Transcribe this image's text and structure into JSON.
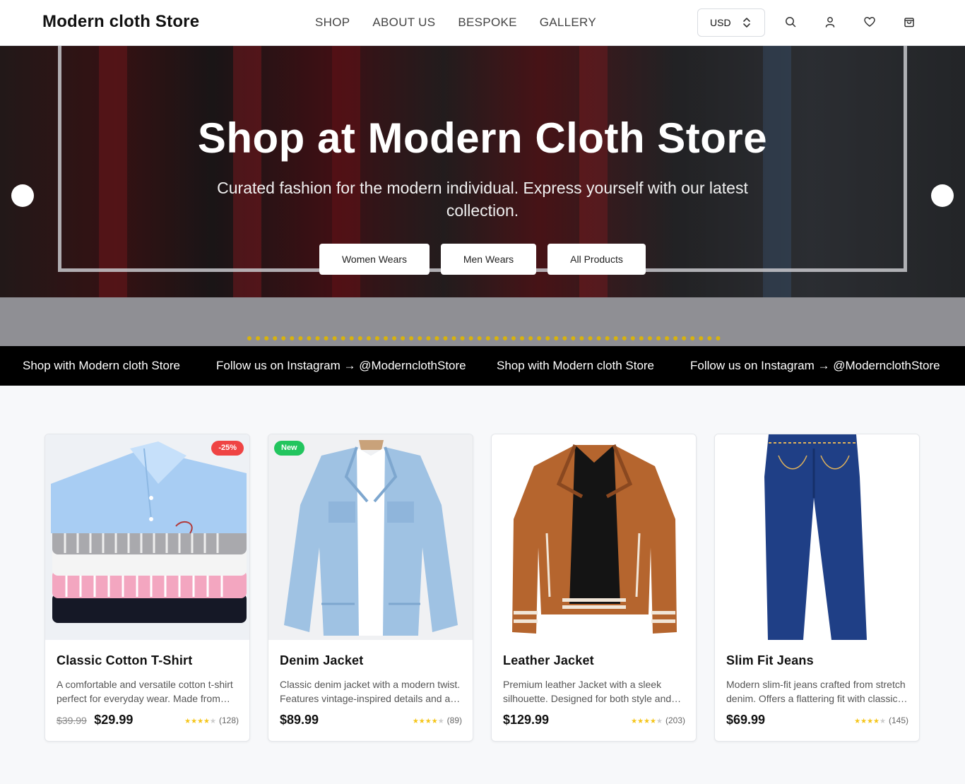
{
  "header": {
    "brand": "Modern cloth Store",
    "nav": [
      "SHOP",
      "ABOUT US",
      "BESPOKE",
      "GALLERY"
    ],
    "currency": "USD",
    "icons": [
      "search-icon",
      "user-icon",
      "heart-icon",
      "bag-icon"
    ]
  },
  "hero": {
    "title": "Shop at Modern Cloth Store",
    "subtitle": "Curated fashion for the modern individual. Express yourself with our latest collection.",
    "buttons": [
      "Women Wears",
      "Men Wears",
      "All Products"
    ]
  },
  "ticker": [
    "Shop with Modern cloth Store",
    "Follow us on Instagram → @ModernclothStore",
    "Shop with Modern cloth Store",
    "Follow us on Instagram → @ModernclothStore"
  ],
  "products": [
    {
      "name": "Classic Cotton T-Shirt",
      "description": "A comfortable and versatile cotton t-shirt perfect for everyday wear. Made from premium cotton.",
      "old_price": "$39.99",
      "price": "$29.99",
      "rating": 4,
      "reviews": "(128)",
      "badge": "-25%",
      "badge_color": "#ef4444"
    },
    {
      "name": "Denim Jacket",
      "description": "Classic denim jacket with a modern twist. Features vintage-inspired details and a relaxed fit.",
      "old_price": "",
      "price": "$89.99",
      "rating": 4,
      "reviews": "(89)",
      "badge": "New",
      "badge_color": "#22c55e"
    },
    {
      "name": "Leather Jacket",
      "description": "Premium leather Jacket with a sleek silhouette. Designed for both style and comfort.",
      "old_price": "",
      "price": "$129.99",
      "rating": 4,
      "reviews": "(203)",
      "badge": "",
      "badge_color": ""
    },
    {
      "name": "Slim Fit Jeans",
      "description": "Modern slim-fit jeans crafted from stretch denim. Offers a flattering fit with classic styling.",
      "old_price": "",
      "price": "$69.99",
      "rating": 4,
      "reviews": "(145)",
      "badge": "",
      "badge_color": ""
    }
  ]
}
